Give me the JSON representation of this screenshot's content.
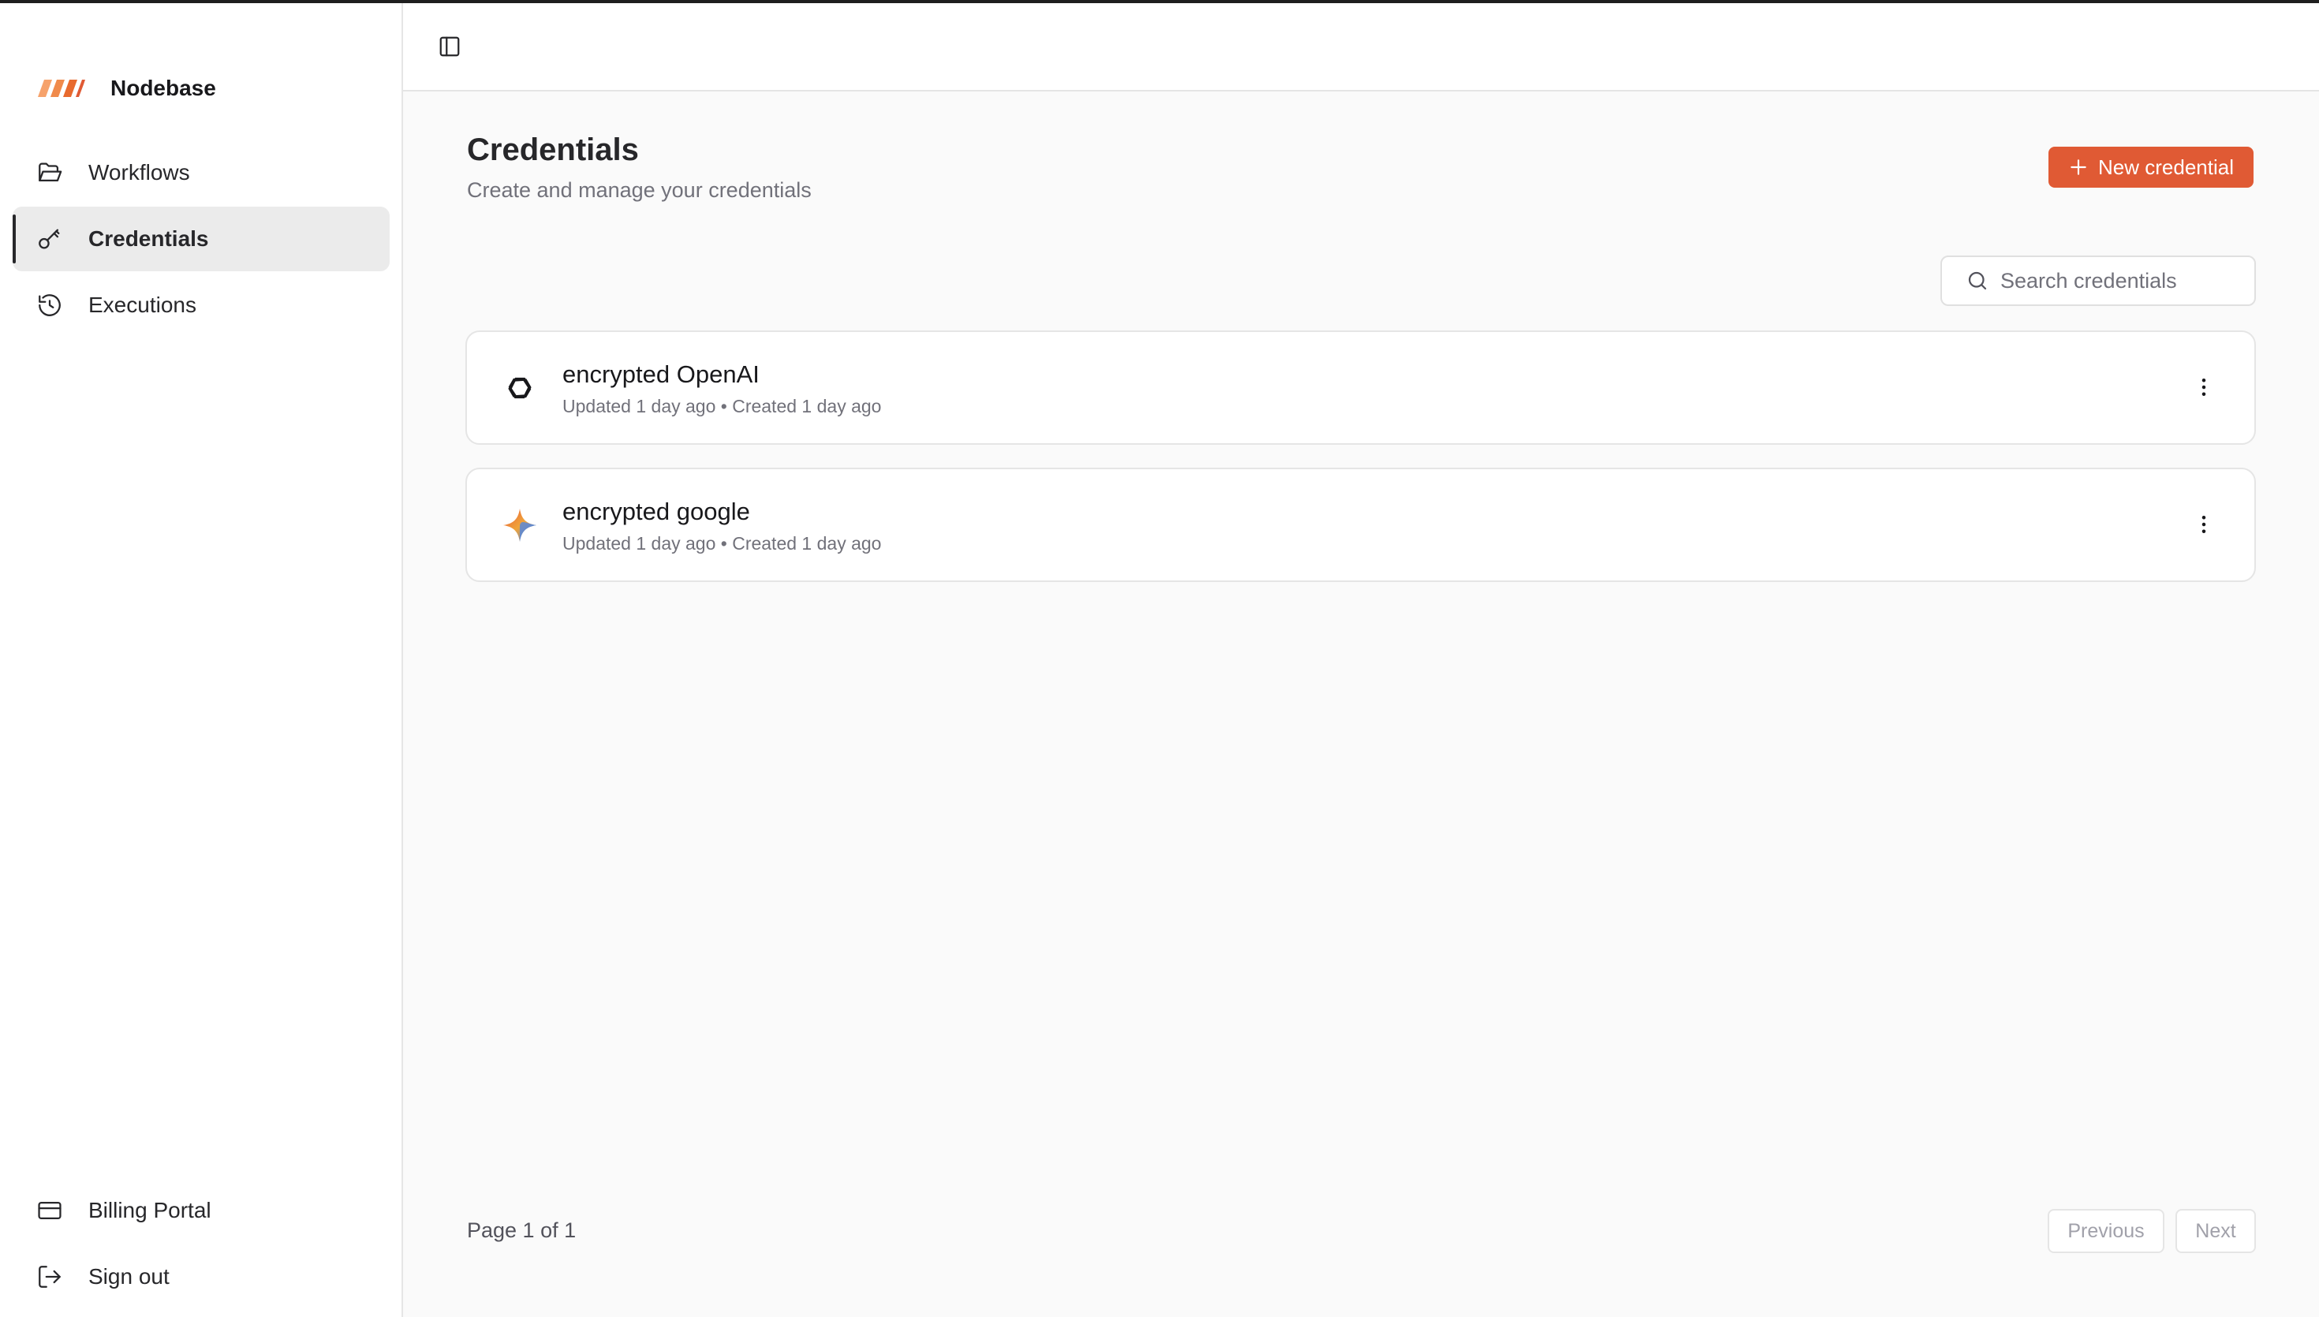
{
  "app": {
    "name": "Nodebase",
    "accent_color": "#e05a34"
  },
  "sidebar": {
    "items": [
      {
        "label": "Workflows",
        "icon": "folder-open-icon",
        "active": false
      },
      {
        "label": "Credentials",
        "icon": "key-icon",
        "active": true
      },
      {
        "label": "Executions",
        "icon": "history-icon",
        "active": false
      }
    ],
    "bottom_items": [
      {
        "label": "Billing Portal",
        "icon": "credit-card-icon"
      },
      {
        "label": "Sign out",
        "icon": "log-out-icon"
      }
    ]
  },
  "header": {
    "toggle_icon": "panel-left-icon"
  },
  "main": {
    "title": "Credentials",
    "subtitle": "Create and manage your credentials",
    "new_button_label": "New credential",
    "search_placeholder": "Search credentials",
    "credentials": [
      {
        "name": "encrypted OpenAI",
        "meta": "Updated 1 day ago • Created 1 day ago",
        "icon": "openai-icon"
      },
      {
        "name": "encrypted google",
        "meta": "Updated 1 day ago • Created 1 day ago",
        "icon": "gemini-icon"
      }
    ],
    "pagination": {
      "info": "Page 1 of 1",
      "previous": "Previous",
      "next": "Next"
    }
  }
}
